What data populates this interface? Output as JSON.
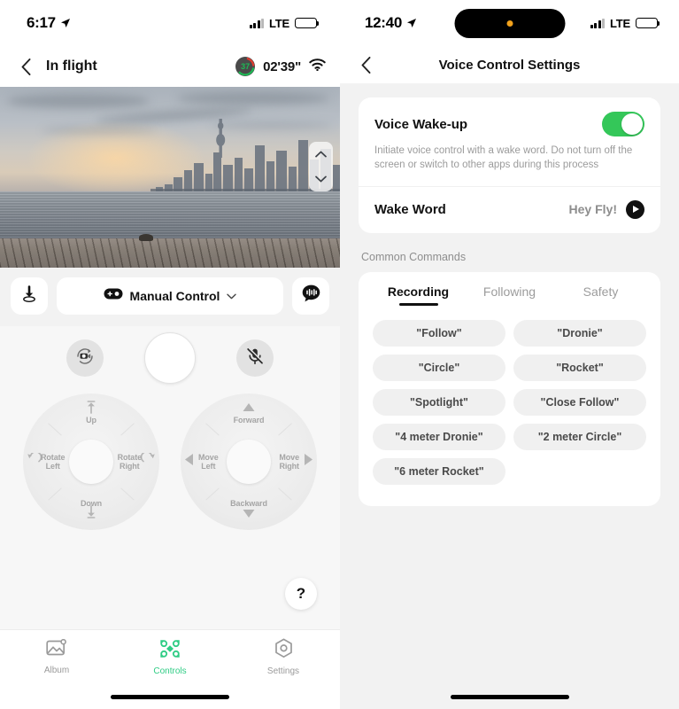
{
  "left_screen": {
    "status_bar": {
      "time": "6:17",
      "location_icon": "location-arrow-icon",
      "carrier": "LTE",
      "signal_icon": "cellular-bars-icon",
      "battery_icon": "battery-icon"
    },
    "nav": {
      "back_icon": "chevron-left-icon",
      "title": "In flight",
      "battery_percent": "37",
      "flight_time": "02'39\"",
      "wifi_icon": "wifi-icon"
    },
    "video": {
      "scene_alt": "Live drone view of city skyline at sunset over water with wooden dock",
      "gimbal_up_icon": "chevron-up-icon",
      "gimbal_down_icon": "chevron-down-icon"
    },
    "control_bar": {
      "land_icon": "land-drone-icon",
      "mode_icon": "gamepad-icon",
      "mode_label": "Manual Control",
      "mode_caret_icon": "chevron-down-icon",
      "voice_icon": "voice-bubble-icon"
    },
    "capture_row": {
      "switch_mode_icon": "camera-video-switch-icon",
      "shutter_icon": "shutter-button",
      "mic_icon": "mic-muted-icon"
    },
    "left_stick": {
      "name": "altitude-rotation-stick",
      "top_label": "Up",
      "bottom_label": "Down",
      "left_label": "Rotate\nLeft",
      "left_label_line1": "Rotate",
      "left_label_line2": "Left",
      "right_label_line1": "Rotate",
      "right_label_line2": "Right",
      "top_icon": "arrow-up-bar-icon",
      "bottom_icon": "arrow-down-bar-icon",
      "left_icon": "rotate-left-icon",
      "right_icon": "rotate-right-icon"
    },
    "right_stick": {
      "name": "movement-stick",
      "top_label": "Forward",
      "bottom_label": "Backward",
      "left_label_line1": "Move",
      "left_label_line2": "Left",
      "right_label_line1": "Move",
      "right_label_line2": "Right",
      "top_icon": "triangle-up-icon",
      "bottom_icon": "triangle-down-icon",
      "left_icon": "triangle-left-icon",
      "right_icon": "triangle-right-icon"
    },
    "help_button_label": "?",
    "tab_bar": {
      "items": [
        {
          "label": "Album",
          "icon": "photo-icon",
          "active": false
        },
        {
          "label": "Controls",
          "icon": "drone-icon",
          "active": true
        },
        {
          "label": "Settings",
          "icon": "hexagon-gear-icon",
          "active": false
        }
      ],
      "active_color": "#2ECC84",
      "inactive_color": "#9a9a9a"
    }
  },
  "right_screen": {
    "status_bar": {
      "time": "12:40",
      "location_icon": "location-arrow-icon",
      "carrier": "LTE",
      "dynamic_island_indicator": "orange-recording-dot"
    },
    "nav": {
      "back_icon": "chevron-left-icon",
      "title": "Voice Control Settings"
    },
    "voice_wakeup": {
      "title": "Voice Wake-up",
      "toggle_on": true,
      "toggle_color": "#34C759",
      "description": "Initiate voice control with a wake word. Do not turn off the screen or switch to other apps during this process",
      "wake_word_label": "Wake Word",
      "wake_word_value": "Hey Fly!",
      "play_icon": "play-icon"
    },
    "common_commands": {
      "section_title": "Common Commands",
      "tabs": [
        {
          "label": "Recording",
          "active": true
        },
        {
          "label": "Following",
          "active": false
        },
        {
          "label": "Safety",
          "active": false
        }
      ],
      "chips": [
        "\"Follow\"",
        "\"Dronie\"",
        "\"Circle\"",
        "\"Rocket\"",
        "\"Spotlight\"",
        "\"Close Follow\"",
        "\"4 meter Dronie\"",
        "\"2 meter Circle\"",
        "\"6 meter Rocket\""
      ]
    }
  }
}
